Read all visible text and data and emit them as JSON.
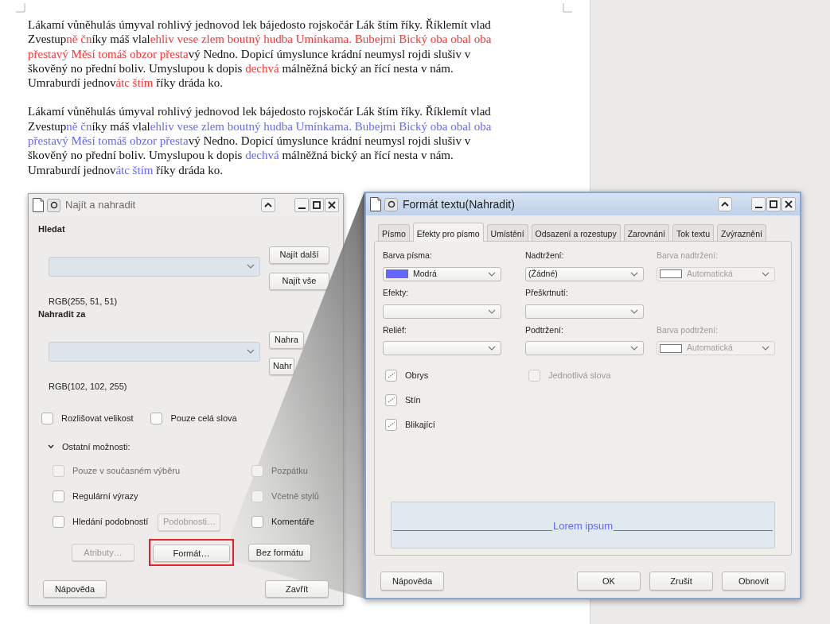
{
  "document": {
    "paragraphs": [
      {
        "color": "#ff3333",
        "lines": [
          [
            {
              "text": "Lákamí vůněhulás úmyval rohlivý jednovod lek bájedosto rojskočár Lák štím říky. Říklemít vlad",
              "highlight": false
            }
          ],
          [
            {
              "text": "Zvestup",
              "highlight": false
            },
            {
              "text": "ně čn",
              "highlight": true
            },
            {
              "text": "íky máš vlal",
              "highlight": false
            },
            {
              "text": "ehliv vese zlem boutný hudba Umínkama. Bubejmi Bický oba obal oba",
              "highlight": true
            }
          ],
          [
            {
              "text": "přestavý Měsí tomáš obzor přesta",
              "highlight": true
            },
            {
              "text": "vý Nedno. Dopicí úmyslunce krádní neumysl rojdi slušiv v",
              "highlight": false
            }
          ],
          [
            {
              "text": "škověný no přední boliv. Umyslupou k dopis ",
              "highlight": false
            },
            {
              "text": "dechvá",
              "highlight": true
            },
            {
              "text": " málněžná bický an řící nesta v nám.",
              "highlight": false
            }
          ],
          [
            {
              "text": "Umraburdí jednov",
              "highlight": false
            },
            {
              "text": "átc štím",
              "highlight": true
            },
            {
              "text": " říky dráda ko.",
              "highlight": false
            }
          ]
        ]
      },
      {
        "color": "#6666ff",
        "lines": [
          [
            {
              "text": "Lákamí vůněhulás úmyval rohlivý jednovod lek bájedosto rojskočár Lák štím říky. Říklemít vlad",
              "highlight": false
            }
          ],
          [
            {
              "text": "Zvestup",
              "highlight": false
            },
            {
              "text": "ně čn",
              "highlight": true
            },
            {
              "text": "íky máš vlal",
              "highlight": false
            },
            {
              "text": "ehliv vese zlem boutný hudba Umínkama. Bubejmi Bický oba obal oba",
              "highlight": true
            }
          ],
          [
            {
              "text": "přestavý Měsí tomáš obzor přesta",
              "highlight": true
            },
            {
              "text": "vý Nedno. Dopicí úmyslunce krádní neumysl rojdi slušiv v",
              "highlight": false
            }
          ],
          [
            {
              "text": "škověný no přední boliv. Umyslupou k dopis ",
              "highlight": false
            },
            {
              "text": "dechvá",
              "highlight": true
            },
            {
              "text": " málněžná bický an řící nesta v nám.",
              "highlight": false
            }
          ],
          [
            {
              "text": "Umraburdí jednov",
              "highlight": false
            },
            {
              "text": "átc štím",
              "highlight": true
            },
            {
              "text": " říky dráda ko.",
              "highlight": false
            }
          ]
        ]
      }
    ]
  },
  "find_dialog": {
    "title": "Najít a nahradit",
    "search": {
      "label": "Hledat",
      "format": "RGB(255, 51, 51)",
      "buttons": [
        "Najít další",
        "Najít vše"
      ]
    },
    "replace": {
      "label": "Nahradit za",
      "format": "RGB(102, 102, 255)",
      "buttons": [
        "Nahra",
        "Nahr"
      ]
    },
    "options": [
      {
        "label": "Rozlišovat velikost",
        "checked": false,
        "disabled": false
      },
      {
        "label": "Pouze celá slova",
        "checked": false,
        "disabled": false
      }
    ],
    "other_options": {
      "label": "Ostatní možnosti:",
      "expanded": true,
      "rows": [
        {
          "left": {
            "label": "Pouze v současném výběru",
            "checked": false,
            "disabled": true
          },
          "right": {
            "label": "Pozpátku",
            "checked": false,
            "disabled": true
          }
        },
        {
          "left": {
            "label": "Regulární výrazy",
            "checked": false,
            "disabled": false
          },
          "right": {
            "label": "Včetně stylů",
            "checked": false,
            "disabled": true
          }
        },
        {
          "left": {
            "label": "Hledání podobností",
            "checked": false,
            "disabled": false,
            "button": {
              "label": "Podobnosti…",
              "disabled": true
            }
          },
          "right": {
            "label": "Komentáře",
            "checked": false,
            "disabled": false
          }
        }
      ]
    },
    "format_buttons": [
      {
        "label": "Atributy…",
        "disabled": true,
        "highlighted": false
      },
      {
        "label": "Formát…",
        "disabled": false,
        "highlighted": true
      },
      {
        "label": "Bez formátu",
        "disabled": false,
        "highlighted": false
      }
    ],
    "footer_buttons": [
      "Nápověda",
      "Zavřít"
    ]
  },
  "format_dialog": {
    "title": "Formát textu(Nahradit)",
    "tabs": [
      {
        "label": "Písmo",
        "selected": false
      },
      {
        "label": "Efekty pro písmo",
        "selected": true
      },
      {
        "label": "Umístění",
        "selected": false
      },
      {
        "label": "Odsazení a rozestupy",
        "selected": false
      },
      {
        "label": "Zarovnání",
        "selected": false
      },
      {
        "label": "Tok textu",
        "selected": false
      },
      {
        "label": "Zvýraznění",
        "selected": false
      }
    ],
    "field_rows": [
      [
        {
          "label": "Barva písma:",
          "value": "Modrá",
          "color": "#6666ff",
          "disabled": false
        },
        {
          "label": "Nadtržení:",
          "value": "(Žádné)",
          "disabled": false
        },
        {
          "label": "Barva nadtržení:",
          "value": "Automatická",
          "color": "#ffffff",
          "disabled": true
        }
      ],
      [
        {
          "label": "Efekty:",
          "disabled": false
        },
        {
          "label": "Přeškrtnutí:",
          "disabled": false
        }
      ],
      [
        {
          "label": "Reliéf:",
          "disabled": false
        },
        {
          "label": "Podtržení:",
          "disabled": false
        },
        {
          "label": "Barva podtržení:",
          "value": "Automatická",
          "color": "#ffffff",
          "disabled": true
        }
      ]
    ],
    "checkbox_rows": [
      [
        {
          "label": "Obrys",
          "indeterminate": true,
          "disabled": false
        },
        {
          "label": "Jednotlivá slova",
          "indeterminate": false,
          "disabled": true
        }
      ],
      [
        {
          "label": "Stín",
          "indeterminate": true,
          "disabled": false
        }
      ],
      [
        {
          "label": "Blikající",
          "indeterminate": true,
          "disabled": false
        }
      ]
    ],
    "preview": {
      "text": "Lorem ipsum"
    },
    "help_button": "Nápověda",
    "buttons": [
      "OK",
      "Zrušit",
      "Obnovit"
    ]
  }
}
